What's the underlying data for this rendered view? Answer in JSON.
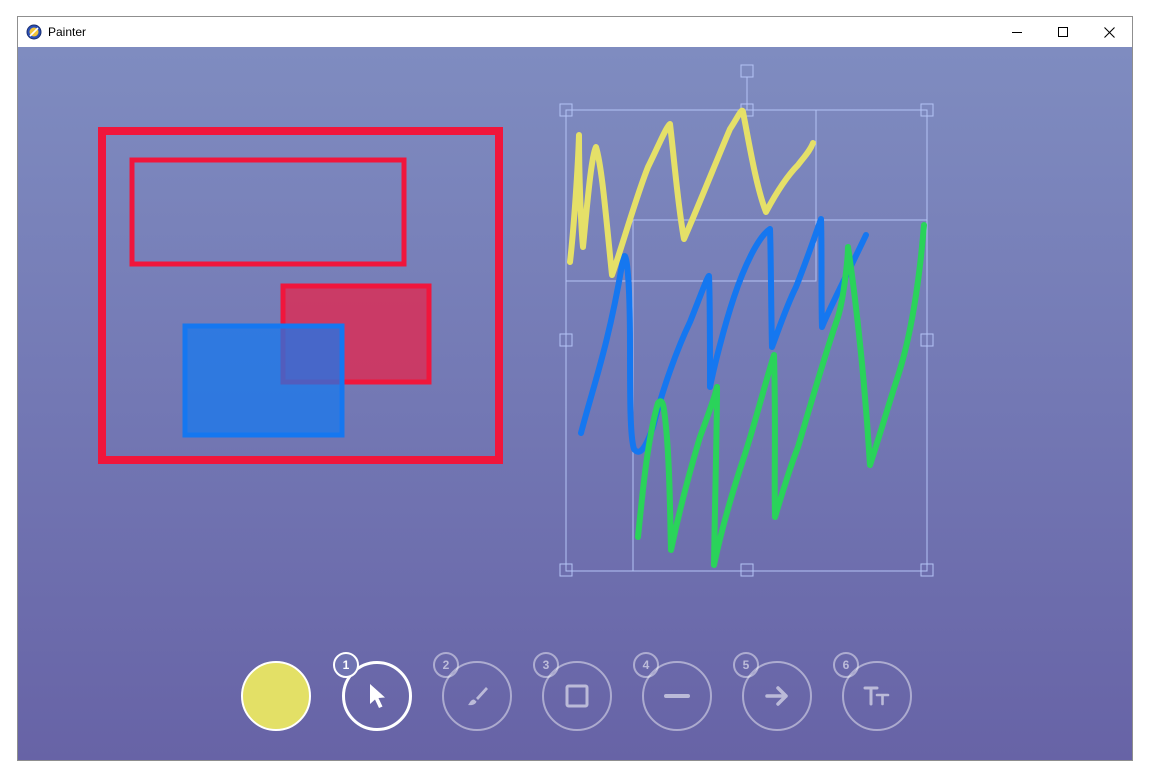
{
  "window": {
    "title": "Painter"
  },
  "colors": {
    "canvas_top": "#7f8cc0",
    "canvas_bottom": "#6763a6",
    "red": "#f0163c",
    "blue": "#1577f0",
    "yellow": "#e5e068",
    "green": "#2ad35a",
    "selection": "#b4c3f5"
  },
  "toolbar": {
    "current_color": "#e3e066",
    "tools": [
      {
        "number": "1",
        "name": "select",
        "icon": "pointer-icon",
        "active": true
      },
      {
        "number": "2",
        "name": "brush",
        "icon": "brush-icon",
        "active": false
      },
      {
        "number": "3",
        "name": "rectangle",
        "icon": "rectangle-icon",
        "active": false
      },
      {
        "number": "4",
        "name": "line",
        "icon": "line-icon",
        "active": false
      },
      {
        "number": "5",
        "name": "arrow",
        "icon": "arrow-icon",
        "active": false
      },
      {
        "number": "6",
        "name": "text",
        "icon": "text-icon",
        "active": false
      }
    ]
  }
}
